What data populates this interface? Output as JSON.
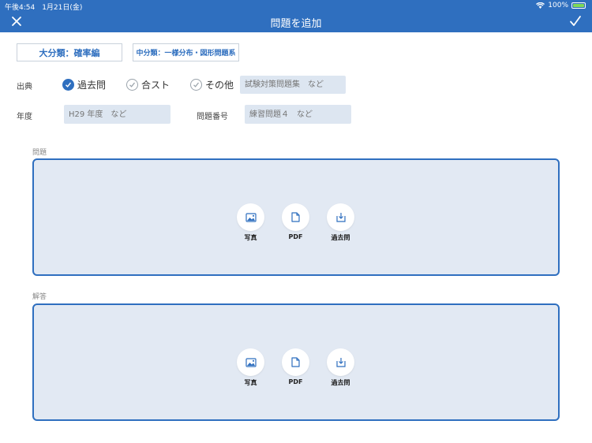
{
  "status": {
    "time_date": "午後4:54　1月21日(金)",
    "battery": "100%"
  },
  "nav": {
    "title": "問題を追加"
  },
  "categories": {
    "main": "大分類：確率編",
    "sub": "中分類：一様分布・図形問題系"
  },
  "source": {
    "label": "出典",
    "options": [
      {
        "label": "過去問",
        "checked": true
      },
      {
        "label": "合スト",
        "checked": false
      },
      {
        "label": "その他",
        "checked": false
      }
    ],
    "other_placeholder": "試験対策問題集　など"
  },
  "year": {
    "label": "年度",
    "placeholder": "H29 年度　など"
  },
  "number": {
    "label": "問題番号",
    "placeholder": "練習問題４　など"
  },
  "question": {
    "label": "問題",
    "actions": [
      {
        "label": "写真",
        "icon": "photo-icon"
      },
      {
        "label": "PDF",
        "icon": "document-icon"
      },
      {
        "label": "過去問",
        "icon": "download-icon"
      }
    ]
  },
  "answer": {
    "label": "解答",
    "actions": [
      {
        "label": "写真",
        "icon": "photo-icon"
      },
      {
        "label": "PDF",
        "icon": "document-icon"
      },
      {
        "label": "過去問",
        "icon": "download-icon"
      }
    ]
  },
  "colors": {
    "accent": "#2f6fbf",
    "field_bg": "#dde6f1",
    "box_bg": "#e2e9f3"
  }
}
